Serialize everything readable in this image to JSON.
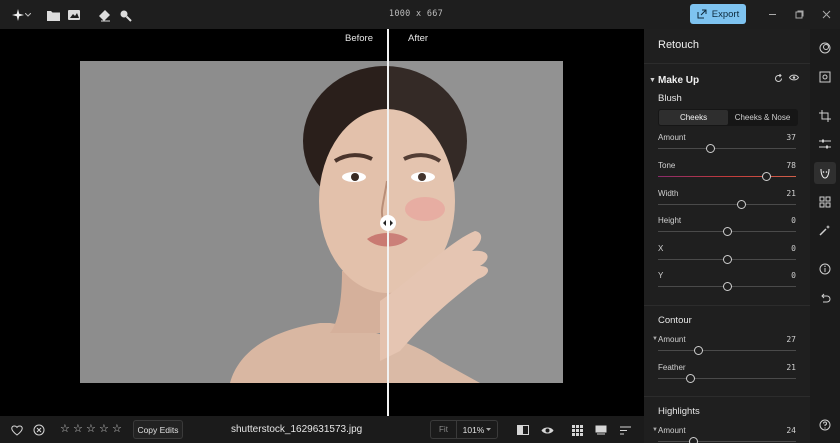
{
  "topbar": {
    "dimensions": "1000 x 667",
    "export_label": "Export",
    "icons": [
      "app-star-icon",
      "chevron-down-icon",
      "folder-icon",
      "image-stack-icon",
      "eraser-icon",
      "search-icon"
    ]
  },
  "canvas": {
    "before_label": "Before",
    "after_label": "After",
    "split_position_fraction": 0.637
  },
  "bottombar": {
    "rating_stars": 5,
    "rating_value": 0,
    "copy_edits_label": "Copy Edits",
    "filename": "shutterstock_1629631573.jpg",
    "fit_label": "Fit",
    "zoom_label": "101%"
  },
  "panel": {
    "title": "Retouch",
    "makeup": {
      "label": "Make Up",
      "blush": {
        "label": "Blush",
        "tabs": [
          "Cheeks",
          "Cheeks & Nose"
        ],
        "active_tab": 0,
        "sliders": [
          {
            "name": "Amount",
            "value": "37",
            "fraction": 0.38
          },
          {
            "name": "Tone",
            "value": "78",
            "fraction": 0.78
          },
          {
            "name": "Width",
            "value": "21",
            "fraction": 0.6
          },
          {
            "name": "Height",
            "value": "0",
            "fraction": 0.5
          },
          {
            "name": "X",
            "value": "0",
            "fraction": 0.5
          },
          {
            "name": "Y",
            "value": "0",
            "fraction": 0.5
          }
        ]
      },
      "contour": {
        "label": "Contour",
        "sliders": [
          {
            "name": "Amount",
            "value": "27",
            "fraction": 0.29
          },
          {
            "name": "Feather",
            "value": "21",
            "fraction": 0.23
          }
        ]
      },
      "highlights": {
        "label": "Highlights",
        "sliders": [
          {
            "name": "Amount",
            "value": "24",
            "fraction": 0.25
          }
        ]
      }
    }
  },
  "colors": {
    "export_button": "#7ec3f0",
    "panel_bg": "#1f1f1f",
    "topbar_bg": "#1e1e1e"
  }
}
